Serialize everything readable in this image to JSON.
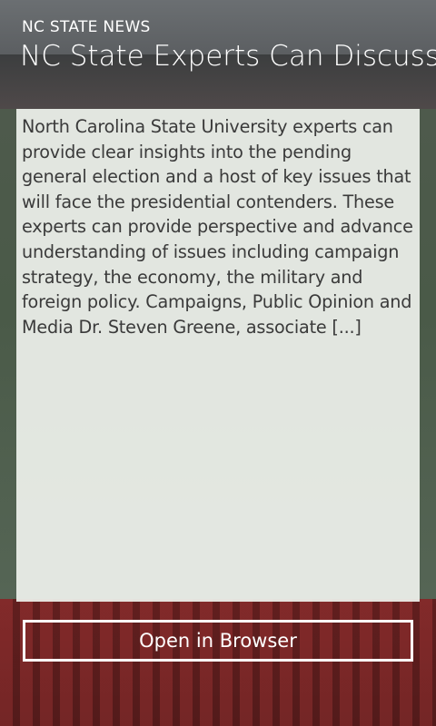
{
  "header": {
    "app_title": "NC STATE NEWS",
    "article_title": "NC State Experts Can Discuss k"
  },
  "article": {
    "body": "North Carolina State University experts can provide clear insights into the pending general election and a host of key issues that will face the presidential contenders. These experts can provide perspective and advance understanding of issues including campaign strategy, the economy, the military and foreign policy. Campaigns, Public Opinion and Media Dr. Steven Greene, associate [...]"
  },
  "actions": {
    "open_browser_label": "Open in Browser"
  },
  "colors": {
    "panel_background": "#eef1ec",
    "text_on_panel": "#3a3a3a",
    "header_text": "#ffffff",
    "button_border": "#ffffff"
  }
}
